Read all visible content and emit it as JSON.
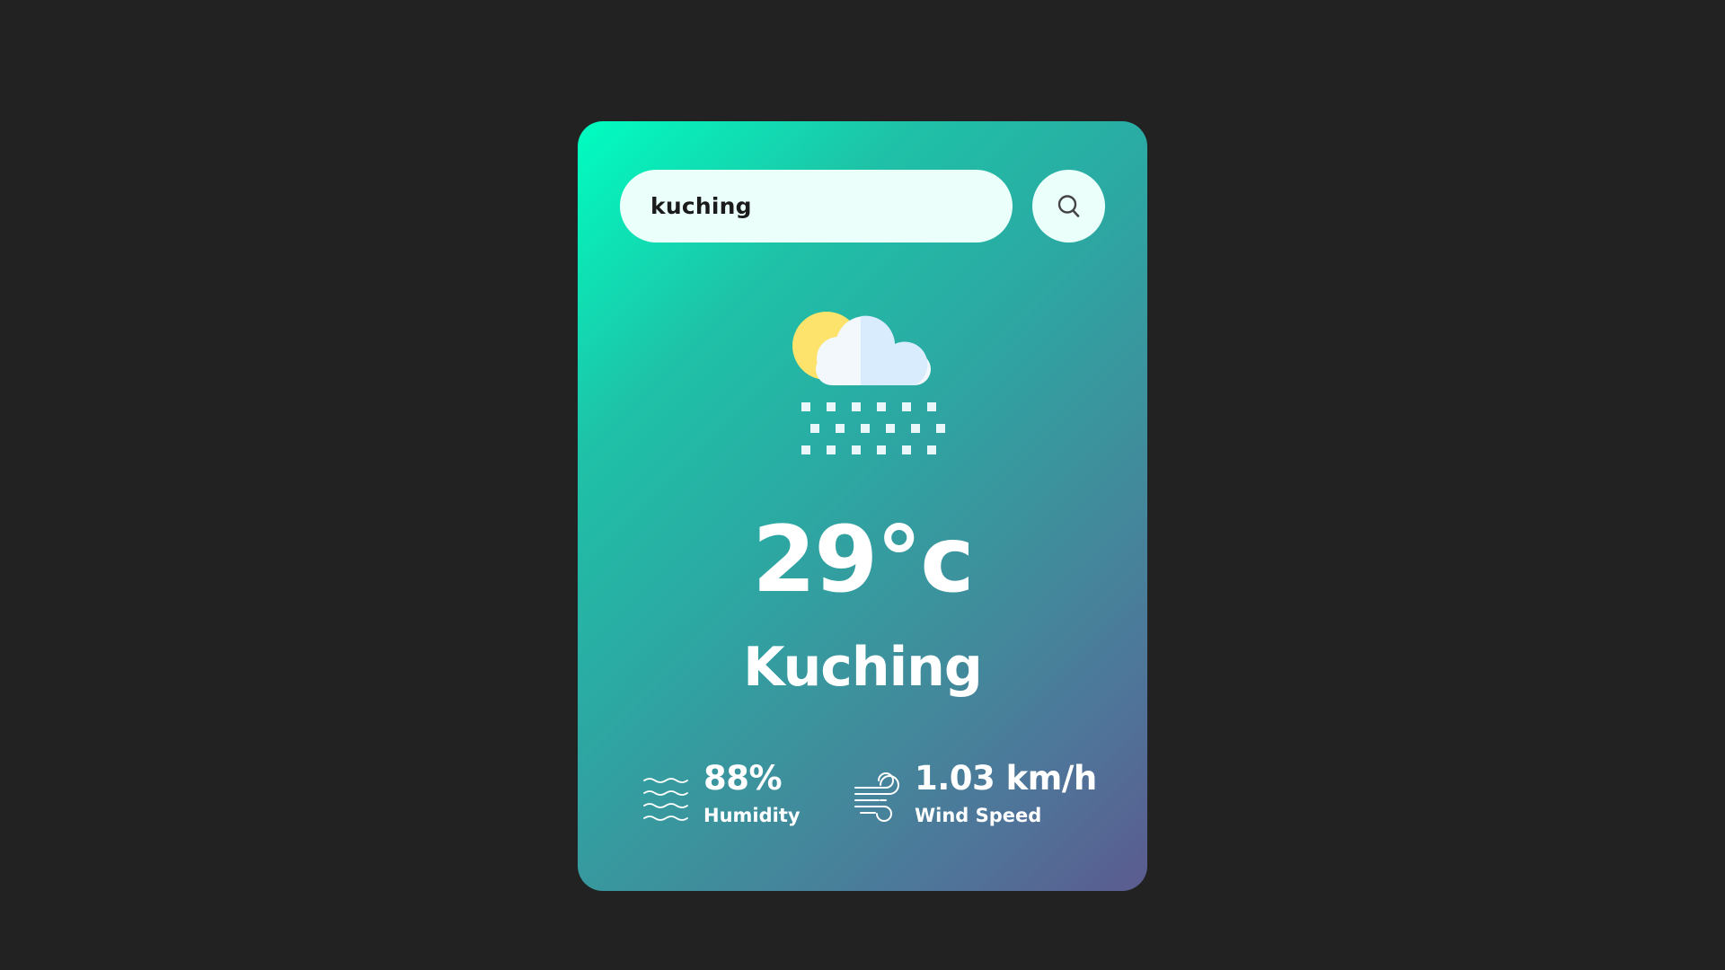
{
  "search": {
    "value": "kuching",
    "icon": "search-icon"
  },
  "weather": {
    "icon": "partly-cloudy-snow-icon",
    "temperature": "29°c",
    "city": "Kuching"
  },
  "details": {
    "humidity": {
      "icon": "humidity-waves-icon",
      "value": "88%",
      "label": "Humidity"
    },
    "wind": {
      "icon": "wind-icon",
      "value": "1.03 km/h",
      "label": "Wind Speed"
    }
  },
  "colors": {
    "background": "#222222",
    "card_gradient_start": "#00fec1",
    "card_gradient_end": "#5b5b8f",
    "input_background": "#ebfffb",
    "text": "#ffffff",
    "sun": "#fde36b",
    "cloud_light": "#f3f8fc",
    "cloud_shade": "#d9ecfd"
  }
}
